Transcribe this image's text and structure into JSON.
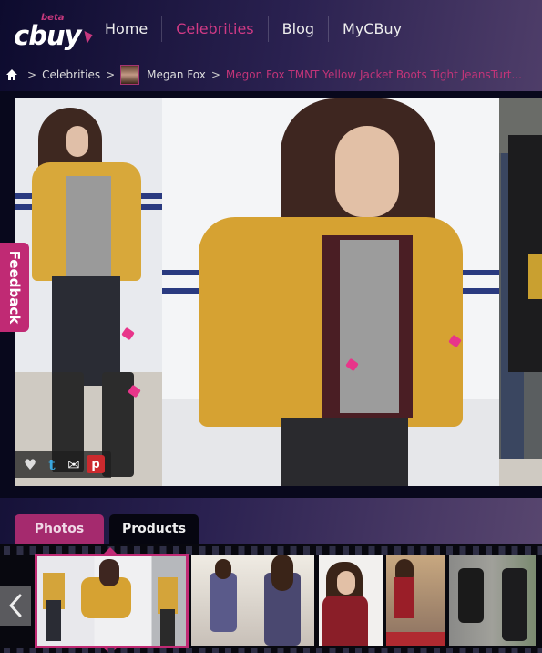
{
  "logo": {
    "word": "cbuy",
    "badge": "beta"
  },
  "nav": {
    "items": [
      {
        "label": "Home",
        "active": false
      },
      {
        "label": "Celebrities",
        "active": true
      },
      {
        "label": "Blog",
        "active": false
      },
      {
        "label": "MyCBuy",
        "active": false
      }
    ]
  },
  "breadcrumb": {
    "home_icon": "home-icon",
    "items": [
      "Celebrities",
      "Megan Fox"
    ],
    "current": "Megon Fox TMNT Yellow Jacket Boots Tight JeansTurt..."
  },
  "feedback": {
    "label": "Feedback"
  },
  "share": {
    "icons": [
      "heart-icon",
      "twitter-icon",
      "email-icon",
      "pinterest-icon"
    ]
  },
  "tabs": [
    {
      "label": "Photos",
      "active": true
    },
    {
      "label": "Products",
      "active": false
    }
  ],
  "colors": {
    "accent": "#c02a74",
    "active_nav": "#d23a85",
    "breadcrumb_current": "#c23478"
  }
}
